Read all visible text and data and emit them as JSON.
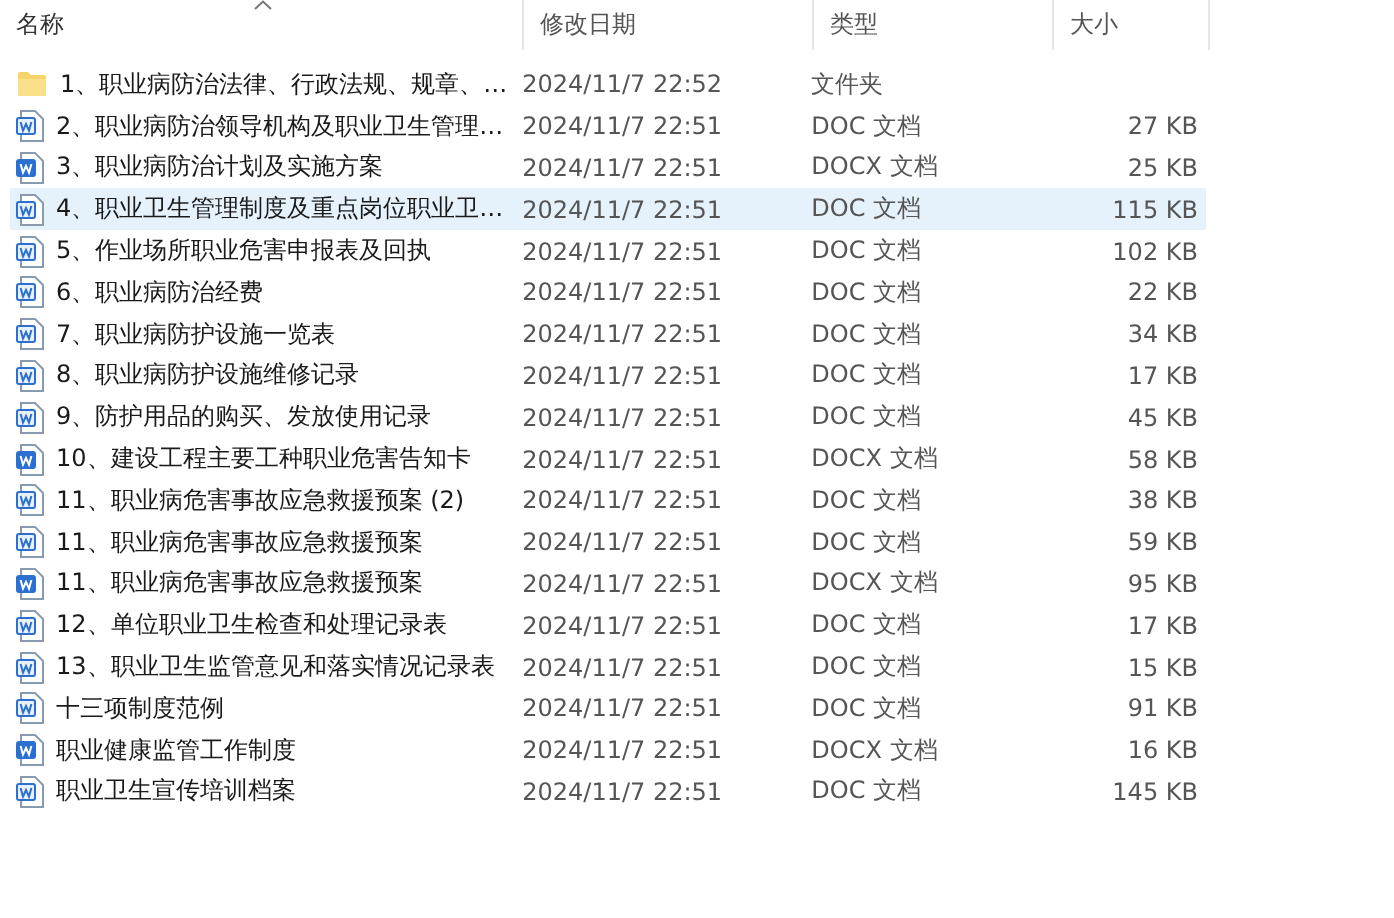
{
  "columns": [
    {
      "label": "名称",
      "sorted": true
    },
    {
      "label": "修改日期",
      "sorted": false
    },
    {
      "label": "类型",
      "sorted": false
    },
    {
      "label": "大小",
      "sorted": false
    }
  ],
  "rows": [
    {
      "kind": "folder",
      "name": "1、职业病防治法律、行政法规、规章、…",
      "date": "2024/11/7 22:52",
      "type": "文件夹",
      "selected": false
    },
    {
      "kind": "doc",
      "name": "2、职业病防治领导机构及职业卫生管理…",
      "date": "2024/11/7 22:51",
      "type": "DOC 文档",
      "size": "27 KB",
      "selected": false
    },
    {
      "kind": "docx",
      "name": "3、职业病防治计划及实施方案",
      "date": "2024/11/7 22:51",
      "type": "DOCX 文档",
      "size": "25 KB",
      "selected": false
    },
    {
      "kind": "doc",
      "name": "4、职业卫生管理制度及重点岗位职业卫…",
      "date": "2024/11/7 22:51",
      "type": "DOC 文档",
      "size": "115 KB",
      "selected": true
    },
    {
      "kind": "doc",
      "name": "5、作业场所职业危害申报表及回执",
      "date": "2024/11/7 22:51",
      "type": "DOC 文档",
      "size": "102 KB",
      "selected": false
    },
    {
      "kind": "doc",
      "name": "6、职业病防治经费",
      "date": "2024/11/7 22:51",
      "type": "DOC 文档",
      "size": "22 KB",
      "selected": false
    },
    {
      "kind": "doc",
      "name": "7、职业病防护设施一览表",
      "date": "2024/11/7 22:51",
      "type": "DOC 文档",
      "size": "34 KB",
      "selected": false
    },
    {
      "kind": "doc",
      "name": "8、职业病防护设施维修记录",
      "date": "2024/11/7 22:51",
      "type": "DOC 文档",
      "size": "17 KB",
      "selected": false
    },
    {
      "kind": "doc",
      "name": "9、防护用品的购买、发放使用记录",
      "date": "2024/11/7 22:51",
      "type": "DOC 文档",
      "size": "45 KB",
      "selected": false
    },
    {
      "kind": "docx",
      "name": "10、建设工程主要工种职业危害告知卡",
      "date": "2024/11/7 22:51",
      "type": "DOCX 文档",
      "size": "58 KB",
      "selected": false
    },
    {
      "kind": "doc",
      "name": "11、职业病危害事故应急救援预案 (2)",
      "date": "2024/11/7 22:51",
      "type": "DOC 文档",
      "size": "38 KB",
      "selected": false
    },
    {
      "kind": "doc",
      "name": "11、职业病危害事故应急救援预案",
      "date": "2024/11/7 22:51",
      "type": "DOC 文档",
      "size": "59 KB",
      "selected": false
    },
    {
      "kind": "docx",
      "name": "11、职业病危害事故应急救援预案",
      "date": "2024/11/7 22:51",
      "type": "DOCX 文档",
      "size": "95 KB",
      "selected": false
    },
    {
      "kind": "doc",
      "name": "12、单位职业卫生检查和处理记录表",
      "date": "2024/11/7 22:51",
      "type": "DOC 文档",
      "size": "17 KB",
      "selected": false
    },
    {
      "kind": "doc",
      "name": "13、职业卫生监管意见和落实情况记录表",
      "date": "2024/11/7 22:51",
      "type": "DOC 文档",
      "size": "15 KB",
      "selected": false
    },
    {
      "kind": "doc",
      "name": "十三项制度范例",
      "date": "2024/11/7 22:51",
      "type": "DOC 文档",
      "size": "91 KB",
      "selected": false
    },
    {
      "kind": "docx",
      "name": "职业健康监管工作制度",
      "date": "2024/11/7 22:51",
      "type": "DOCX 文档",
      "size": "16 KB",
      "selected": false
    },
    {
      "kind": "doc",
      "name": "职业卫生宣传培训档案",
      "date": "2024/11/7 22:51",
      "type": "DOC 文档",
      "size": "145 KB",
      "selected": false
    }
  ]
}
